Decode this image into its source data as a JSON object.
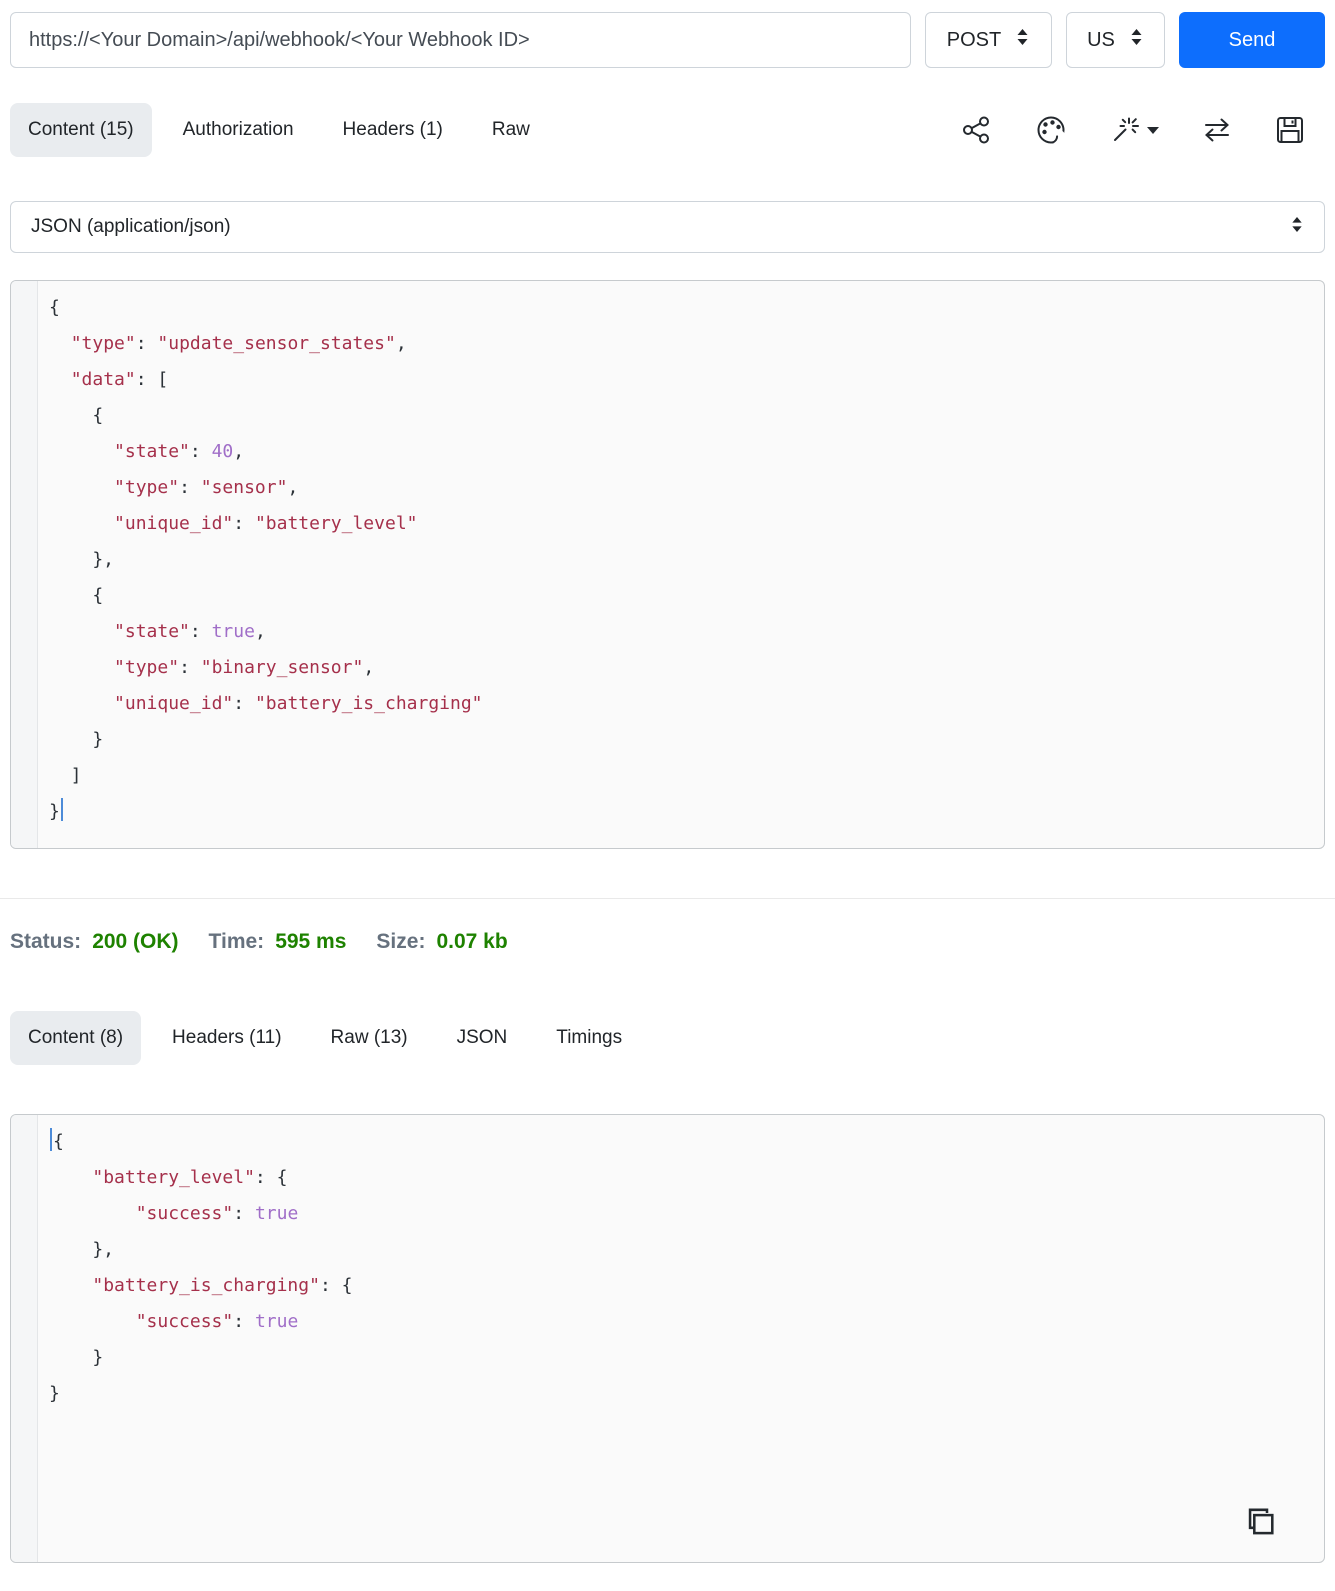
{
  "request_bar": {
    "url": "https://<Your Domain>/api/webhook/<Your Webhook ID>",
    "method": "POST",
    "region": "US",
    "send_label": "Send"
  },
  "request_tabs": [
    {
      "label": "Content (15)",
      "active": true
    },
    {
      "label": "Authorization",
      "active": false
    },
    {
      "label": "Headers (1)",
      "active": false
    },
    {
      "label": "Raw",
      "active": false
    }
  ],
  "toolbar_icons": [
    "share-icon",
    "palette-icon",
    "magic-wand-icon",
    "swap-arrows-icon",
    "save-icon"
  ],
  "body_type": {
    "value": "JSON (application/json)"
  },
  "request_body_lines": [
    [
      {
        "t": "p",
        "v": "{"
      }
    ],
    [
      {
        "t": "p",
        "v": "  "
      },
      {
        "t": "s",
        "v": "\"type\""
      },
      {
        "t": "p",
        "v": ": "
      },
      {
        "t": "s",
        "v": "\"update_sensor_states\""
      },
      {
        "t": "p",
        "v": ","
      }
    ],
    [
      {
        "t": "p",
        "v": "  "
      },
      {
        "t": "s",
        "v": "\"data\""
      },
      {
        "t": "p",
        "v": ": ["
      }
    ],
    [
      {
        "t": "p",
        "v": "    {"
      }
    ],
    [
      {
        "t": "p",
        "v": "      "
      },
      {
        "t": "s",
        "v": "\"state\""
      },
      {
        "t": "p",
        "v": ": "
      },
      {
        "t": "v",
        "v": "40"
      },
      {
        "t": "p",
        "v": ","
      }
    ],
    [
      {
        "t": "p",
        "v": "      "
      },
      {
        "t": "s",
        "v": "\"type\""
      },
      {
        "t": "p",
        "v": ": "
      },
      {
        "t": "s",
        "v": "\"sensor\""
      },
      {
        "t": "p",
        "v": ","
      }
    ],
    [
      {
        "t": "p",
        "v": "      "
      },
      {
        "t": "s",
        "v": "\"unique_id\""
      },
      {
        "t": "p",
        "v": ": "
      },
      {
        "t": "s",
        "v": "\"battery_level\""
      }
    ],
    [
      {
        "t": "p",
        "v": "    },"
      }
    ],
    [
      {
        "t": "p",
        "v": "    {"
      }
    ],
    [
      {
        "t": "p",
        "v": "      "
      },
      {
        "t": "s",
        "v": "\"state\""
      },
      {
        "t": "p",
        "v": ": "
      },
      {
        "t": "v",
        "v": "true"
      },
      {
        "t": "p",
        "v": ","
      }
    ],
    [
      {
        "t": "p",
        "v": "      "
      },
      {
        "t": "s",
        "v": "\"type\""
      },
      {
        "t": "p",
        "v": ": "
      },
      {
        "t": "s",
        "v": "\"binary_sensor\""
      },
      {
        "t": "p",
        "v": ","
      }
    ],
    [
      {
        "t": "p",
        "v": "      "
      },
      {
        "t": "s",
        "v": "\"unique_id\""
      },
      {
        "t": "p",
        "v": ": "
      },
      {
        "t": "s",
        "v": "\"battery_is_charging\""
      }
    ],
    [
      {
        "t": "p",
        "v": "    }"
      }
    ],
    [
      {
        "t": "p",
        "v": "  ]"
      }
    ],
    [
      {
        "t": "p",
        "v": "}"
      },
      {
        "t": "c",
        "v": ""
      }
    ]
  ],
  "response_summary": {
    "status_label": "Status:",
    "status_value": "200 (OK)",
    "time_label": "Time:",
    "time_value": "595 ms",
    "size_label": "Size:",
    "size_value": "0.07 kb"
  },
  "response_tabs": [
    {
      "label": "Content (8)",
      "active": true
    },
    {
      "label": "Headers (11)",
      "active": false
    },
    {
      "label": "Raw (13)",
      "active": false
    },
    {
      "label": "JSON",
      "active": false
    },
    {
      "label": "Timings",
      "active": false
    }
  ],
  "response_body_lines": [
    [
      {
        "t": "c",
        "v": ""
      },
      {
        "t": "p",
        "v": "{"
      }
    ],
    [
      {
        "t": "p",
        "v": "    "
      },
      {
        "t": "s",
        "v": "\"battery_level\""
      },
      {
        "t": "p",
        "v": ": {"
      }
    ],
    [
      {
        "t": "p",
        "v": "        "
      },
      {
        "t": "s",
        "v": "\"success\""
      },
      {
        "t": "p",
        "v": ": "
      },
      {
        "t": "v",
        "v": "true"
      }
    ],
    [
      {
        "t": "p",
        "v": "    },"
      }
    ],
    [
      {
        "t": "p",
        "v": "    "
      },
      {
        "t": "s",
        "v": "\"battery_is_charging\""
      },
      {
        "t": "p",
        "v": ": {"
      }
    ],
    [
      {
        "t": "p",
        "v": "        "
      },
      {
        "t": "s",
        "v": "\"success\""
      },
      {
        "t": "p",
        "v": ": "
      },
      {
        "t": "v",
        "v": "true"
      }
    ],
    [
      {
        "t": "p",
        "v": "    }"
      }
    ],
    [
      {
        "t": "p",
        "v": "}"
      }
    ]
  ],
  "colors": {
    "accent_blue": "#0d6efd",
    "status_green": "#1e8200",
    "status_label_gray": "#66717e",
    "code_string_red": "#a5304b",
    "code_value_purple": "#a06ec8",
    "active_tab_bg": "#e9ecef",
    "cursor_blue": "#4c8bd8"
  }
}
